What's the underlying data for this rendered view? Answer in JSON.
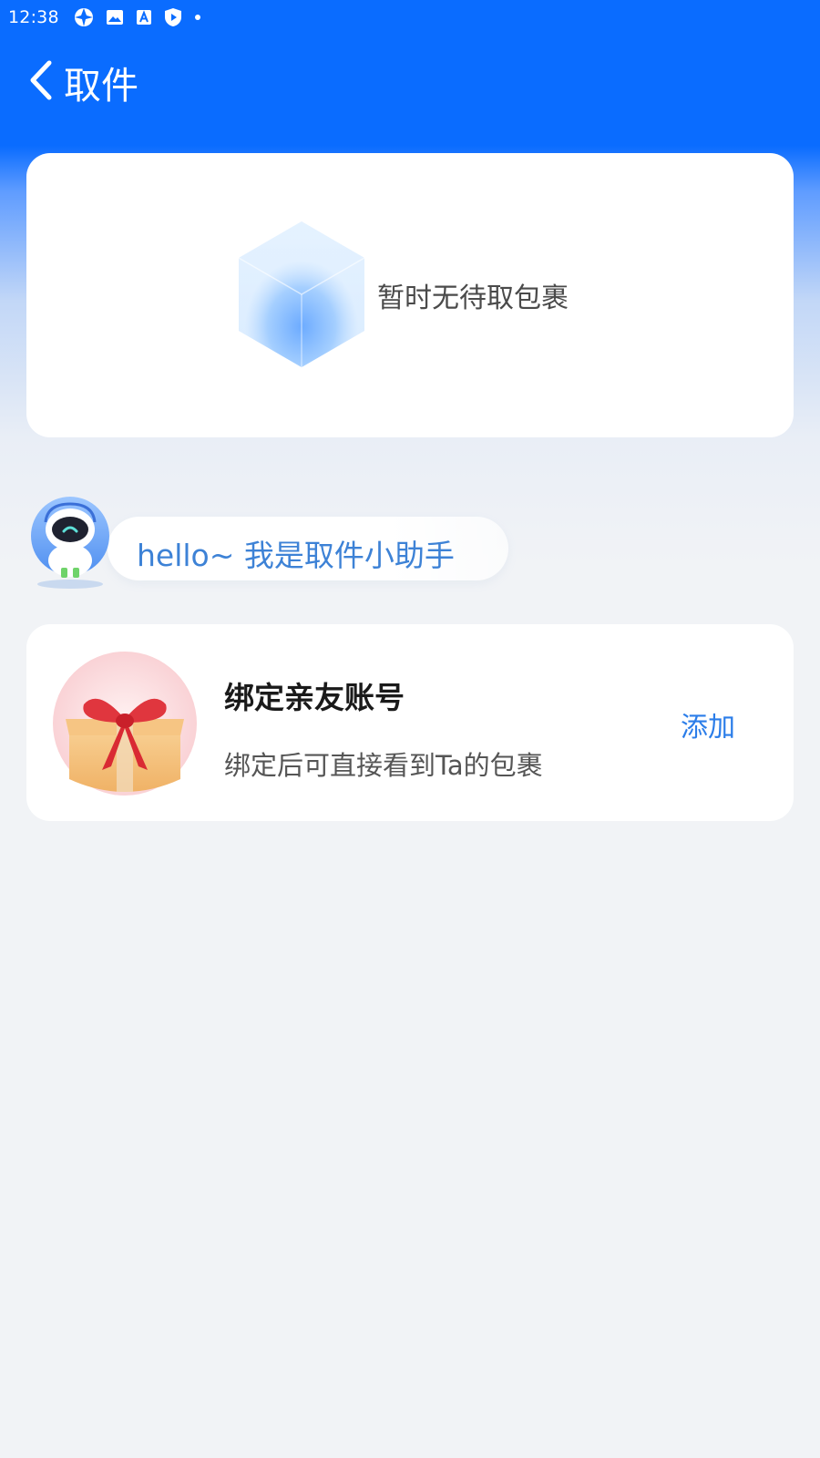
{
  "status_bar": {
    "time": "12:38",
    "icons": [
      "aperture-icon",
      "image-icon",
      "font-icon",
      "play-shield-icon",
      "dot-icon"
    ]
  },
  "header": {
    "back_icon": "chevron-left-icon",
    "title": "取件"
  },
  "empty_state": {
    "icon": "cube-icon",
    "text": "暂时无待取包裹"
  },
  "assistant": {
    "avatar_icon": "robot-avatar-icon",
    "greeting": "hello~ 我是取件小助手"
  },
  "bind_card": {
    "icon": "gift-box-icon",
    "title": "绑定亲友账号",
    "subtitle": "绑定后可直接看到Ta的包裹",
    "action_label": "添加"
  },
  "colors": {
    "primary_blue": "#0a6cff",
    "link_blue": "#2b7de9",
    "page_bg": "#f1f3f6"
  }
}
